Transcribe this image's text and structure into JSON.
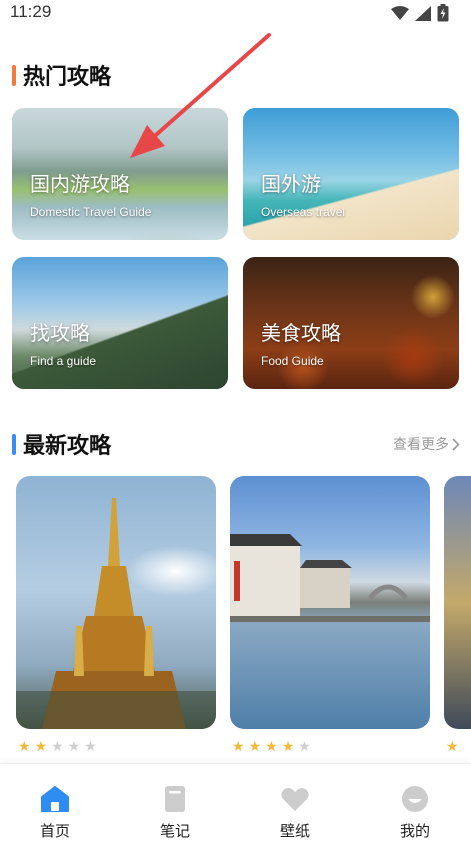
{
  "status_bar": {
    "time": "11:29"
  },
  "hot": {
    "title": "热门攻略",
    "accent_color": "#f07b3f",
    "cards": [
      {
        "title": "国内游攻略",
        "subtitle": "Domestic Travel Guide"
      },
      {
        "title": "国外游",
        "subtitle": "Overseas travel"
      },
      {
        "title": "找攻略",
        "subtitle": "Find a guide"
      },
      {
        "title": "美食攻略",
        "subtitle": "Food Guide"
      }
    ]
  },
  "latest": {
    "title": "最新攻略",
    "accent_color": "#3b8cf0",
    "more_label": "查看更多",
    "items": [
      {
        "image": "golden-pagoda",
        "rating": 2,
        "max": 5
      },
      {
        "image": "water-town-canal",
        "rating": 4,
        "max": 5
      },
      {
        "image": "partial-next-card",
        "rating": 1,
        "max": 1
      }
    ]
  },
  "annotation": {
    "arrow_color": "#e8474a"
  },
  "nav": {
    "active_color": "#2f8cf5",
    "inactive_color": "#cccccc",
    "items": [
      {
        "label": "首页",
        "icon": "home-icon",
        "active": true
      },
      {
        "label": "笔记",
        "icon": "notebook-icon",
        "active": false
      },
      {
        "label": "壁纸",
        "icon": "heart-icon",
        "active": false
      },
      {
        "label": "我的",
        "icon": "profile-icon",
        "active": false
      }
    ]
  }
}
